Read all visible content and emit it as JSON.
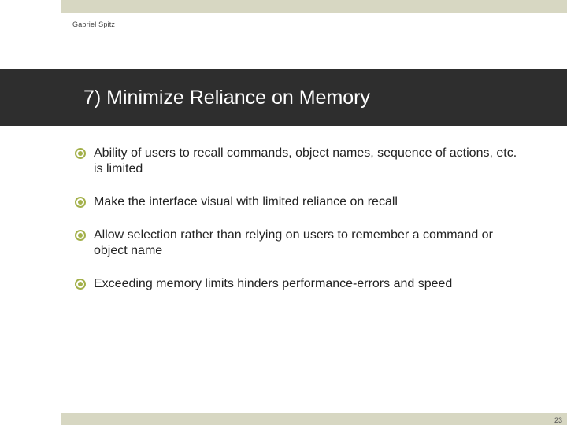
{
  "author": "Gabriel Spitz",
  "title": "7) Minimize Reliance on Memory",
  "bullets": [
    "Ability of users to recall commands, object names, sequence of actions, etc. is limited",
    "Make the interface visual with limited reliance on recall",
    "Allow selection rather than relying on users to remember a command or object name",
    "Exceeding memory limits hinders performance-errors and speed"
  ],
  "page_number": "23",
  "colors": {
    "accent": "#a3b04a",
    "band": "#d7d7c2",
    "title_bg": "#2e2e2e"
  }
}
